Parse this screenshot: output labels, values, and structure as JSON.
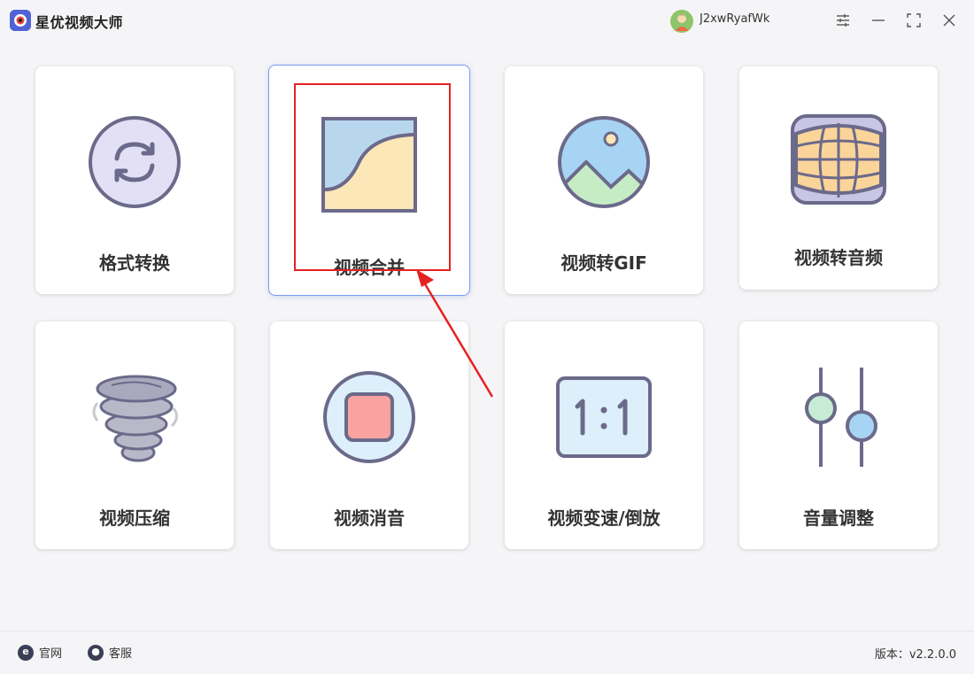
{
  "app": {
    "title": "星优视频大师"
  },
  "user": {
    "name": "J2xwRyafWk"
  },
  "tools": [
    {
      "label": "格式转换",
      "icon": "format-convert-icon"
    },
    {
      "label": "视频合并",
      "icon": "video-merge-icon"
    },
    {
      "label": "视频转GIF",
      "icon": "video-gif-icon"
    },
    {
      "label": "视频转音频",
      "icon": "video-audio-icon"
    },
    {
      "label": "视频压缩",
      "icon": "video-compress-icon"
    },
    {
      "label": "视频消音",
      "icon": "video-mute-icon"
    },
    {
      "label": "视频变速/倒放",
      "icon": "video-speed-icon"
    },
    {
      "label": "音量调整",
      "icon": "volume-adjust-icon"
    }
  ],
  "footer": {
    "website_label": "官网",
    "support_label": "客服",
    "version_text": "版本：v2.2.0.0"
  },
  "colors": {
    "accent": "#7d9cf0",
    "highlight": "#e52222",
    "icon_stroke": "#6b6a8a"
  }
}
